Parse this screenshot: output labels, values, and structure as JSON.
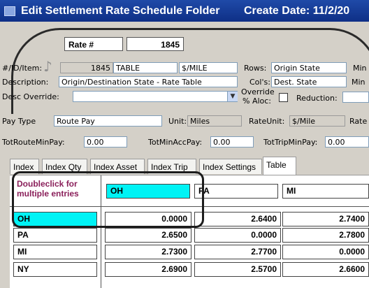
{
  "window": {
    "title": "Edit Settlement Rate Schedule Folder",
    "create_date": "Create Date: 11/2/20"
  },
  "rate": {
    "label": "Rate #",
    "value": "1845"
  },
  "fields": {
    "id_item_label": "#/ID/Item:",
    "id_value": "1845",
    "item_value": "TABLE",
    "unit_value": "$/MILE",
    "rows_label": "Rows:",
    "rows_value": "Origin State",
    "min_label_1": "Min",
    "description_label": "Description:",
    "description_value": "Origin/Destination State - Rate Table",
    "cols_label": "Col's:",
    "cols_value": "Dest. State",
    "min_label_2": "Min",
    "desc_override_label": "Desc Override:",
    "desc_override_value": "",
    "override_label_1": "Override",
    "override_label_2": "% Aloc:",
    "reduction_label": "Reduction:",
    "pay_type_label": "Pay Type",
    "pay_type_value": "Route Pay",
    "unit_label": "Unit:",
    "unit_field_value": "Miles",
    "rate_unit_label": "RateUnit:",
    "rate_unit_value": "$/Mile",
    "rate_label_cut": "Rate",
    "tot_route_label": "TotRouteMinPay:",
    "tot_route_value": "0.00",
    "tot_min_acc_label": "TotMinAccPay:",
    "tot_min_acc_value": "0.00",
    "tot_trip_label": "TotTripMinPay:",
    "tot_trip_value": "0.00"
  },
  "tabs": [
    "Index",
    "Index Qty",
    "Index Asset",
    "Index Trip",
    "Index Settings",
    "Table"
  ],
  "active_tab": "Table",
  "table": {
    "hint_line1": "Doubleclick for",
    "hint_line2": "multiple entries",
    "columns": [
      "OH",
      "PA",
      "MI"
    ],
    "rows": [
      {
        "label": "OH",
        "values": [
          "0.0000",
          "2.6400",
          "2.7400"
        ]
      },
      {
        "label": "PA",
        "values": [
          "2.6500",
          "0.0000",
          "2.7800"
        ]
      },
      {
        "label": "MI",
        "values": [
          "2.7300",
          "2.7700",
          "0.0000"
        ]
      },
      {
        "label": "NY",
        "values": [
          "2.6900",
          "2.5700",
          "2.6600"
        ]
      }
    ]
  },
  "colors": {
    "titlebar": "#0e2f86",
    "selected_cell": "#00f3f5",
    "hint_text": "#8a1f5a"
  },
  "icons": {
    "window_icon": "app-icon",
    "note_icon": "music-note-icon",
    "dropdown": "chevron-down-icon"
  }
}
